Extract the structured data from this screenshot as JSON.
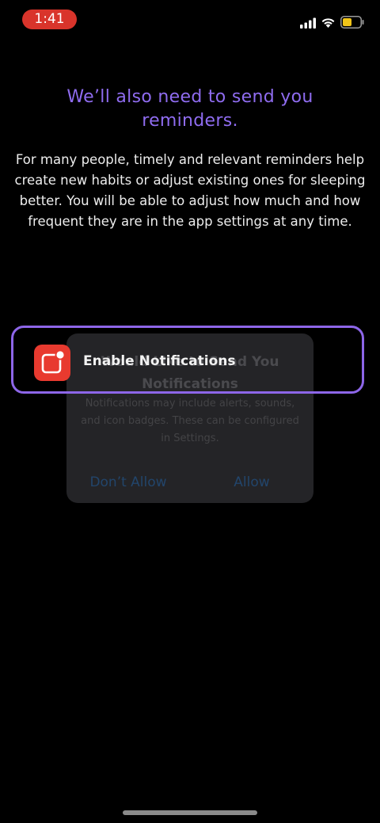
{
  "status_bar": {
    "time": "1:41",
    "time_pill_color": "#d9342b",
    "battery_color": "#f0c419",
    "icons": [
      "signal-icon",
      "wifi-icon",
      "battery-icon"
    ]
  },
  "onboarding": {
    "title": "We’ll also need to send you reminders.",
    "body": "For many people, timely and relevant reminders help create new habits or adjust existing ones for sleeping better. You will be able to adjust how much and how frequent they are in the app settings at any time.",
    "accent_color": "#8f6cf0"
  },
  "system_alert": {
    "title": "Would Like to Send You Notifications",
    "message": "Notifications may include alerts, sounds, and icon badges. These can be configured in Settings.",
    "deny_label": "Don’t Allow",
    "allow_label": "Allow"
  },
  "banner": {
    "label": "Enable Notifications",
    "icon": "notification-app-icon",
    "highlight_color": "#8d66e8"
  }
}
